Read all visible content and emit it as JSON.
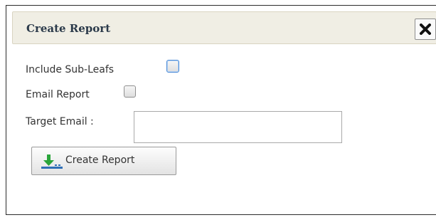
{
  "dialog": {
    "title": "Create Report",
    "close_icon": "close-x-icon"
  },
  "form": {
    "include_sub_leafs_label": "Include Sub-Leafs",
    "include_sub_leafs_checked": false,
    "email_report_label": "Email Report",
    "email_report_checked": false,
    "target_email_label": "Target Email :",
    "target_email_value": "",
    "create_button_label": "Create Report",
    "create_button_icon": "download-icon"
  },
  "colors": {
    "titlebar_bg": "#f0eee4",
    "title_text": "#2b3a4a",
    "checkbox_focus": "#4b8ad6",
    "download_icon": "#2aa53a"
  }
}
